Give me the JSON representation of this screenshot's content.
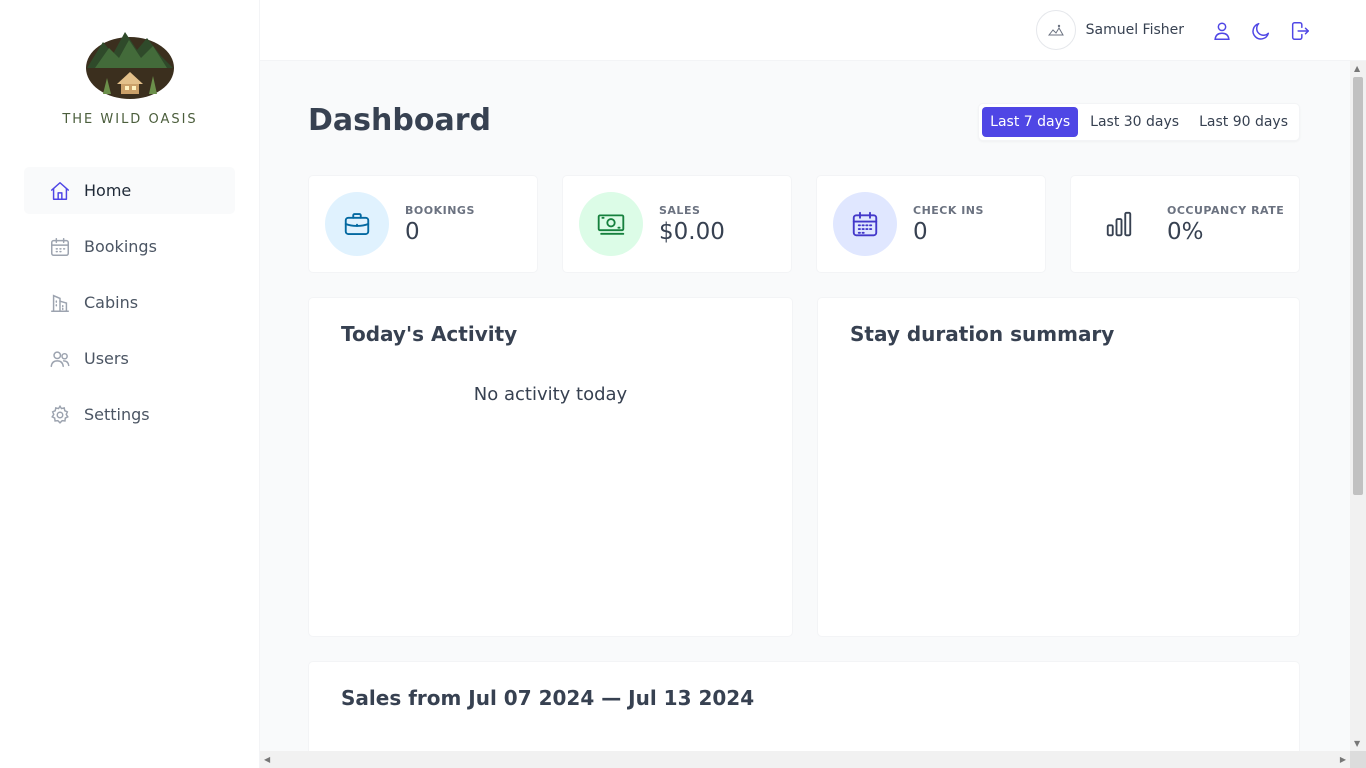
{
  "app": {
    "logo_text": "THE WILD OASIS"
  },
  "sidebar": {
    "items": [
      {
        "label": "Home",
        "icon": "home-icon",
        "active": true
      },
      {
        "label": "Bookings",
        "icon": "calendar-icon",
        "active": false
      },
      {
        "label": "Cabins",
        "icon": "building-icon",
        "active": false
      },
      {
        "label": "Users",
        "icon": "users-icon",
        "active": false
      },
      {
        "label": "Settings",
        "icon": "gear-icon",
        "active": false
      }
    ]
  },
  "header": {
    "user_name": "Samuel Fisher",
    "icons": [
      "user-icon",
      "moon-icon",
      "logout-icon"
    ]
  },
  "main": {
    "title": "Dashboard",
    "filters": [
      {
        "label": "Last 7 days",
        "active": true
      },
      {
        "label": "Last 30 days",
        "active": false
      },
      {
        "label": "Last 90 days",
        "active": false
      }
    ],
    "stats": [
      {
        "label": "BOOKINGS",
        "value": "0",
        "icon": "briefcase-icon",
        "color": "#e0f2fe",
        "icon_color": "#0369a1"
      },
      {
        "label": "SALES",
        "value": "$0.00",
        "icon": "banknotes-icon",
        "color": "#dcfce7",
        "icon_color": "#15803d"
      },
      {
        "label": "CHECK INS",
        "value": "0",
        "icon": "calendar-days-icon",
        "color": "#e0e7ff",
        "icon_color": "#4338ca"
      },
      {
        "label": "OCCUPANCY RATE",
        "value": "0%",
        "icon": "chart-bar-icon",
        "color": "#ffffff",
        "icon_color": "#374151"
      }
    ],
    "activity": {
      "title": "Today's Activity",
      "empty_text": "No activity today"
    },
    "duration": {
      "title": "Stay duration summary"
    },
    "sales": {
      "title": "Sales from Jul 07 2024 — Jul 13 2024"
    }
  },
  "colors": {
    "accent": "#4f46e5",
    "background": "#f9fafb"
  }
}
